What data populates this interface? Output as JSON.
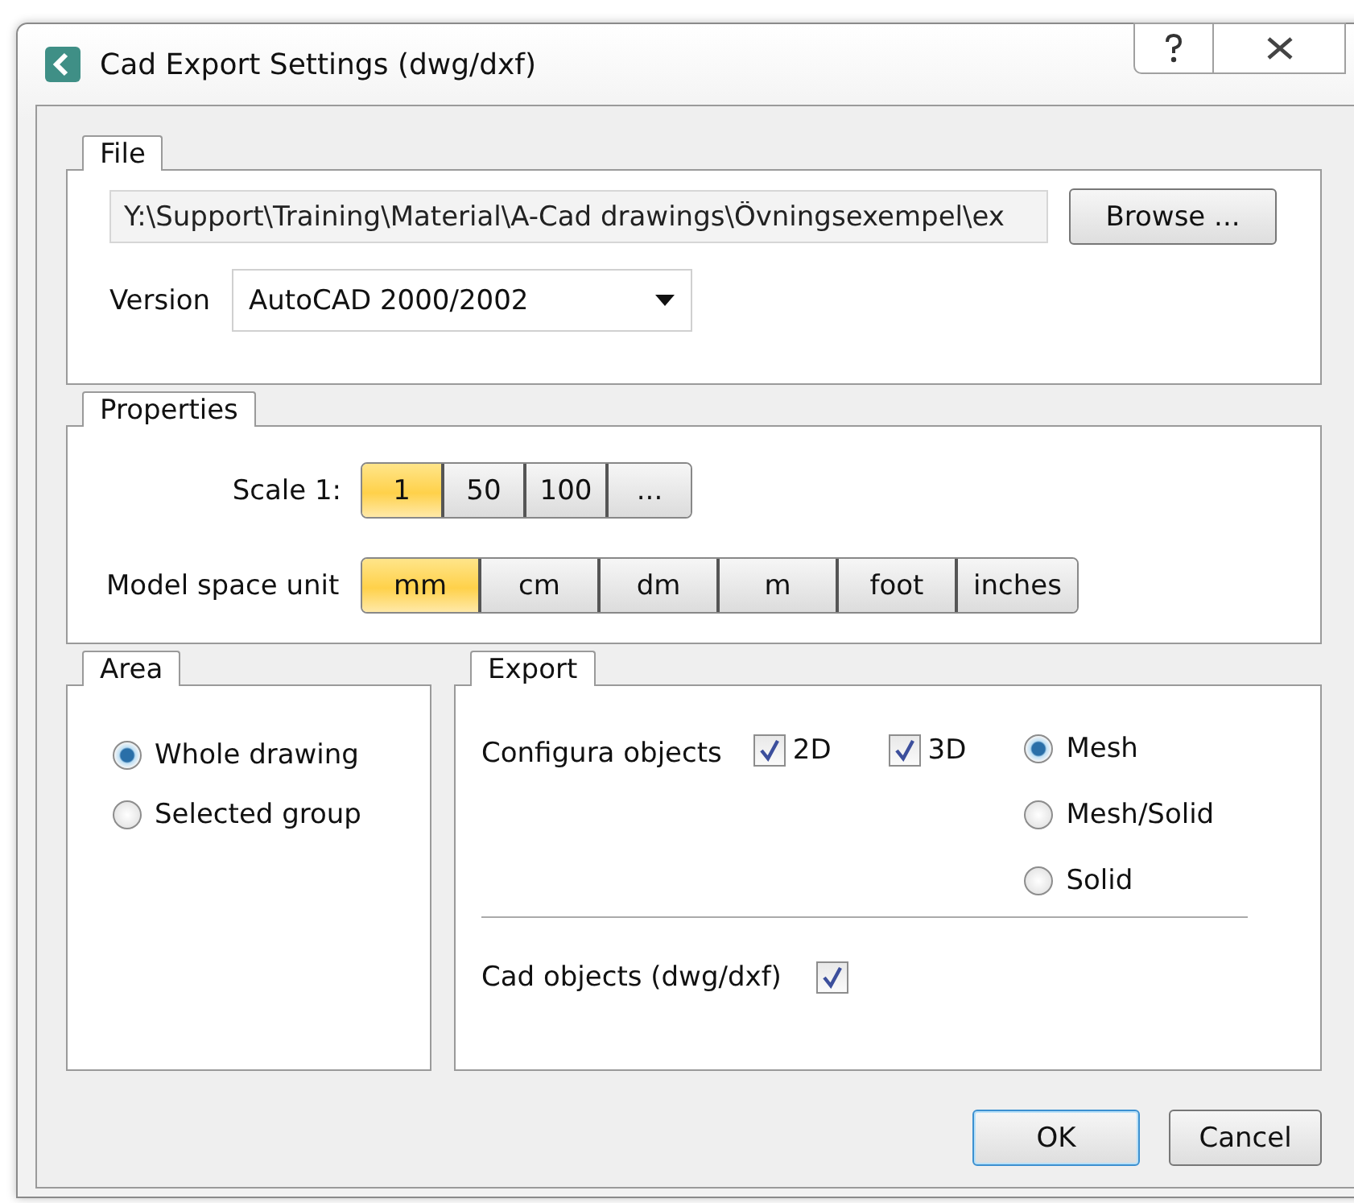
{
  "window": {
    "title": "Cad Export Settings (dwg/dxf)"
  },
  "file": {
    "label": "File",
    "path": "Y:\\Support\\Training\\Material\\A-Cad drawings\\Övningsexempel\\ex",
    "browse_button": "Browse ...",
    "version_label": "Version",
    "version_value": "AutoCAD 2000/2002"
  },
  "properties": {
    "label": "Properties",
    "scale_label": "Scale 1:",
    "scale_options": [
      {
        "label": "1",
        "selected": true
      },
      {
        "label": "50",
        "selected": false
      },
      {
        "label": "100",
        "selected": false
      },
      {
        "label": "...",
        "selected": false
      }
    ],
    "unit_label": "Model space unit",
    "unit_options": [
      {
        "label": "mm",
        "selected": true
      },
      {
        "label": "cm",
        "selected": false
      },
      {
        "label": "dm",
        "selected": false
      },
      {
        "label": "m",
        "selected": false
      },
      {
        "label": "foot",
        "selected": false
      },
      {
        "label": "inches",
        "selected": false
      }
    ]
  },
  "area": {
    "label": "Area",
    "options": [
      {
        "label": "Whole drawing",
        "selected": true
      },
      {
        "label": "Selected group",
        "selected": false
      }
    ]
  },
  "export": {
    "label": "Export",
    "configura_label": "Configura objects",
    "checkboxes": [
      {
        "label": "2D",
        "checked": true
      },
      {
        "label": "3D",
        "checked": true
      }
    ],
    "modes": [
      {
        "label": "Mesh",
        "selected": true
      },
      {
        "label": "Mesh/Solid",
        "selected": false
      },
      {
        "label": "Solid",
        "selected": false
      }
    ],
    "cad_label": "Cad objects (dwg/dxf)",
    "cad_checked": true
  },
  "buttons": [
    {
      "label": "OK",
      "kind": "default"
    },
    {
      "label": "Cancel",
      "kind": "normal"
    }
  ]
}
